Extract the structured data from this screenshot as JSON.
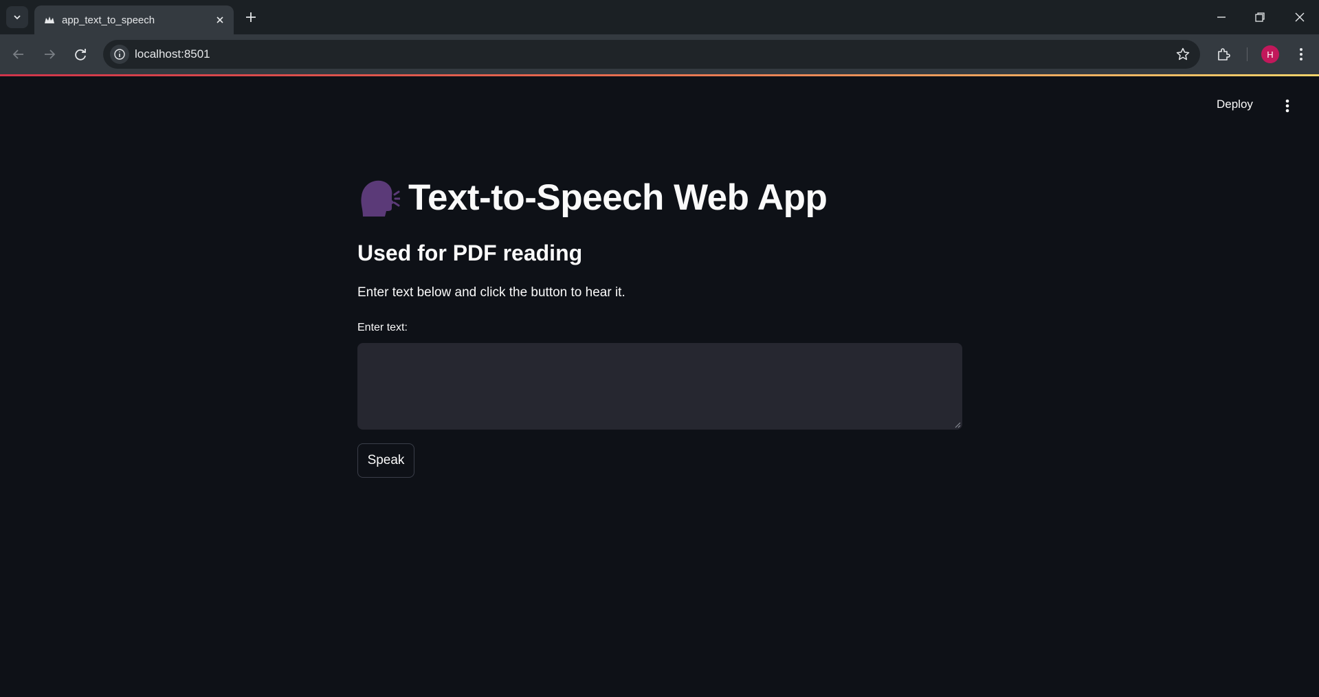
{
  "browser": {
    "tab_title": "app_text_to_speech",
    "url": "localhost:8501",
    "avatar_letter": "H",
    "icons": [
      "tab-search-icon",
      "streamlit-favicon",
      "close-icon",
      "plus-icon",
      "minimize-icon",
      "restore-icon",
      "window-close-icon",
      "back-arrow-icon",
      "forward-arrow-icon",
      "reload-icon",
      "site-info-icon",
      "star-icon",
      "extensions-icon",
      "kebab-menu-icon"
    ]
  },
  "app": {
    "deploy_label": "Deploy",
    "title_emoji": "speaking-head",
    "title": "Text-to-Speech Web App",
    "subheader": "Used for PDF reading",
    "description": "Enter text below and click the button to hear it.",
    "input": {
      "label": "Enter text:",
      "value": "",
      "placeholder": ""
    },
    "speak_label": "Speak"
  },
  "colors": {
    "app_background": "#0e1117",
    "input_background": "#262730",
    "text": "#fafafa",
    "avatar": "#c2185b"
  }
}
